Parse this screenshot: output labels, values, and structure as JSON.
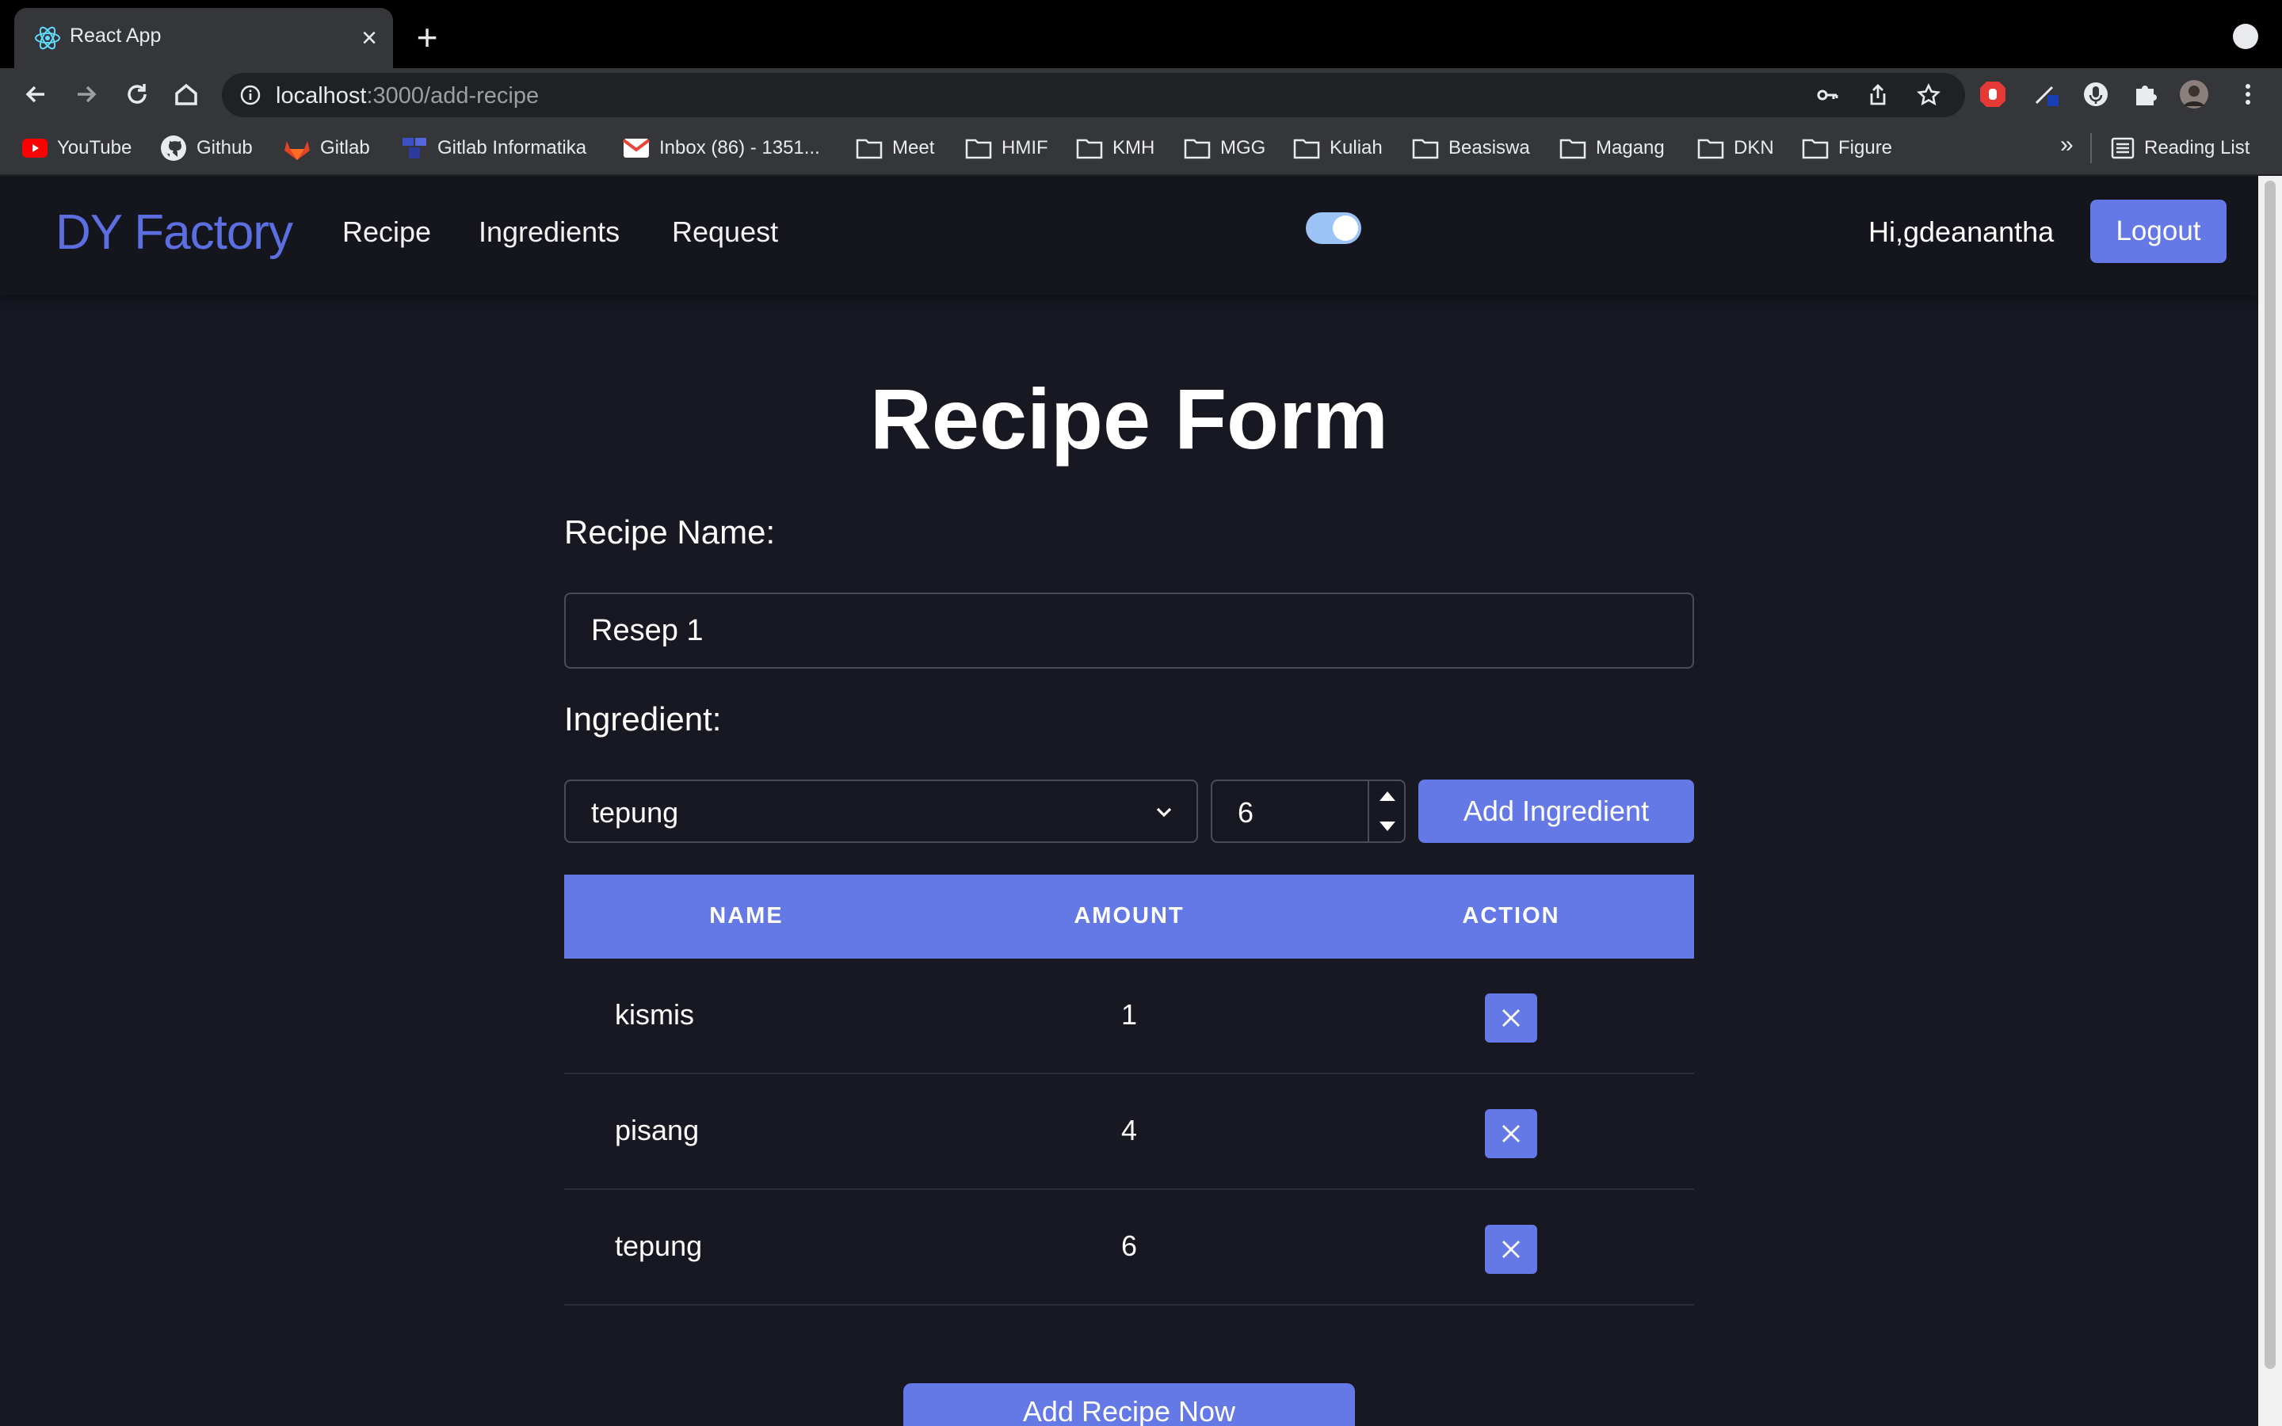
{
  "browser": {
    "tab_title": "React App",
    "url_host": "localhost",
    "url_path": ":3000/add-recipe",
    "bookmarks": [
      {
        "label": "YouTube",
        "icon": "youtube-icon"
      },
      {
        "label": "Github",
        "icon": "github-icon"
      },
      {
        "label": "Gitlab",
        "icon": "gitlab-icon"
      },
      {
        "label": "Gitlab Informatika",
        "icon": "gitlab-informatika-icon"
      },
      {
        "label": "Inbox (86) - 1351...",
        "icon": "gmail-icon"
      },
      {
        "label": "Meet",
        "icon": "folder-icon"
      },
      {
        "label": "HMIF",
        "icon": "folder-icon"
      },
      {
        "label": "KMH",
        "icon": "folder-icon"
      },
      {
        "label": "MGG",
        "icon": "folder-icon"
      },
      {
        "label": "Kuliah",
        "icon": "folder-icon"
      },
      {
        "label": "Beasiswa",
        "icon": "folder-icon"
      },
      {
        "label": "Magang",
        "icon": "folder-icon"
      },
      {
        "label": "DKN",
        "icon": "folder-icon"
      },
      {
        "label": "Figure",
        "icon": "folder-icon"
      }
    ],
    "bookmarks_more": "»",
    "reading_list": "Reading List"
  },
  "nav": {
    "brand": "DY Factory",
    "links": [
      "Recipe",
      "Ingredients",
      "Request"
    ],
    "greeting": "Hi,gdeanantha",
    "logout": "Logout",
    "theme_toggle_on": true
  },
  "form": {
    "title": "Recipe Form",
    "recipe_name_label": "Recipe Name:",
    "recipe_name_value": "Resep 1",
    "ingredient_label": "Ingredient:",
    "ingredient_selected": "tepung",
    "amount_value": "6",
    "add_ingredient": "Add Ingredient",
    "submit": "Add Recipe Now"
  },
  "table": {
    "headers": [
      "NAME",
      "AMOUNT",
      "ACTION"
    ],
    "rows": [
      {
        "name": "kismis",
        "amount": "1"
      },
      {
        "name": "pisang",
        "amount": "4"
      },
      {
        "name": "tepung",
        "amount": "6"
      }
    ]
  },
  "colors": {
    "accent": "#6478e6",
    "brand": "#5b6fe0",
    "background": "#171822",
    "navbar": "#14151d"
  }
}
